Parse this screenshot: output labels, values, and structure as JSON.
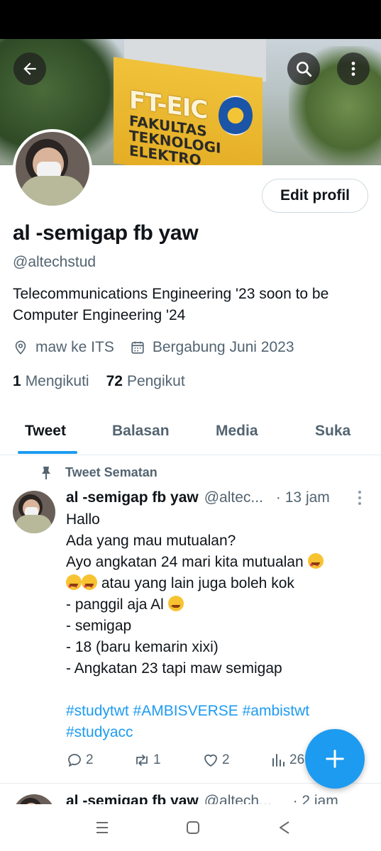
{
  "banner": {
    "sign_big": "FT-EIC",
    "sign_line1": "FAKULTAS",
    "sign_line2": "TEKNOLOGI",
    "sign_line3": "ELEKTRO"
  },
  "header": {
    "back_icon": "arrow-left-icon",
    "search_icon": "search-icon",
    "more_icon": "more-vertical-icon"
  },
  "profile": {
    "edit_button": "Edit profil",
    "name": "al -semigap fb yaw",
    "handle": "@altechstud",
    "bio_line1": "Telecommunications Engineering '23  soon to be",
    "bio_line2": "Computer Engineering '24",
    "location": "maw ke ITS",
    "joined": "Bergabung Juni 2023",
    "following_count": "1",
    "following_label": "Mengikuti",
    "followers_count": "72",
    "followers_label": "Pengikut"
  },
  "tabs": [
    "Tweet",
    "Balasan",
    "Media",
    "Suka"
  ],
  "pinned_label": "Tweet Sematan",
  "tweet": {
    "name": "al -semigap fb yaw",
    "handle": "@altec...",
    "time": "· 13 jam",
    "line1": "Hallo",
    "line2": "Ada yang mau mutualan?",
    "line3": "Ayo angkatan 24 mari kita mutualan",
    "line4": " atau yang lain juga boleh kok",
    "line5": "- panggil aja Al",
    "line6": "- semigap",
    "line7": "- 18 (baru kemarin xixi)",
    "line8": "- Angkatan 23 tapi maw semigap",
    "hashtags1": "#studytwt #AMBISVERSE #ambistwt",
    "hashtags2": "#studyacc",
    "replies": "2",
    "retweets": "1",
    "likes": "2",
    "views": "26"
  },
  "tweet2": {
    "name": "al -semigap fb yaw",
    "handle": "@altech...",
    "time": "· 2 jam"
  },
  "colors": {
    "accent": "#1d9bf0",
    "text_primary": "#0f1419",
    "text_secondary": "#536471"
  }
}
